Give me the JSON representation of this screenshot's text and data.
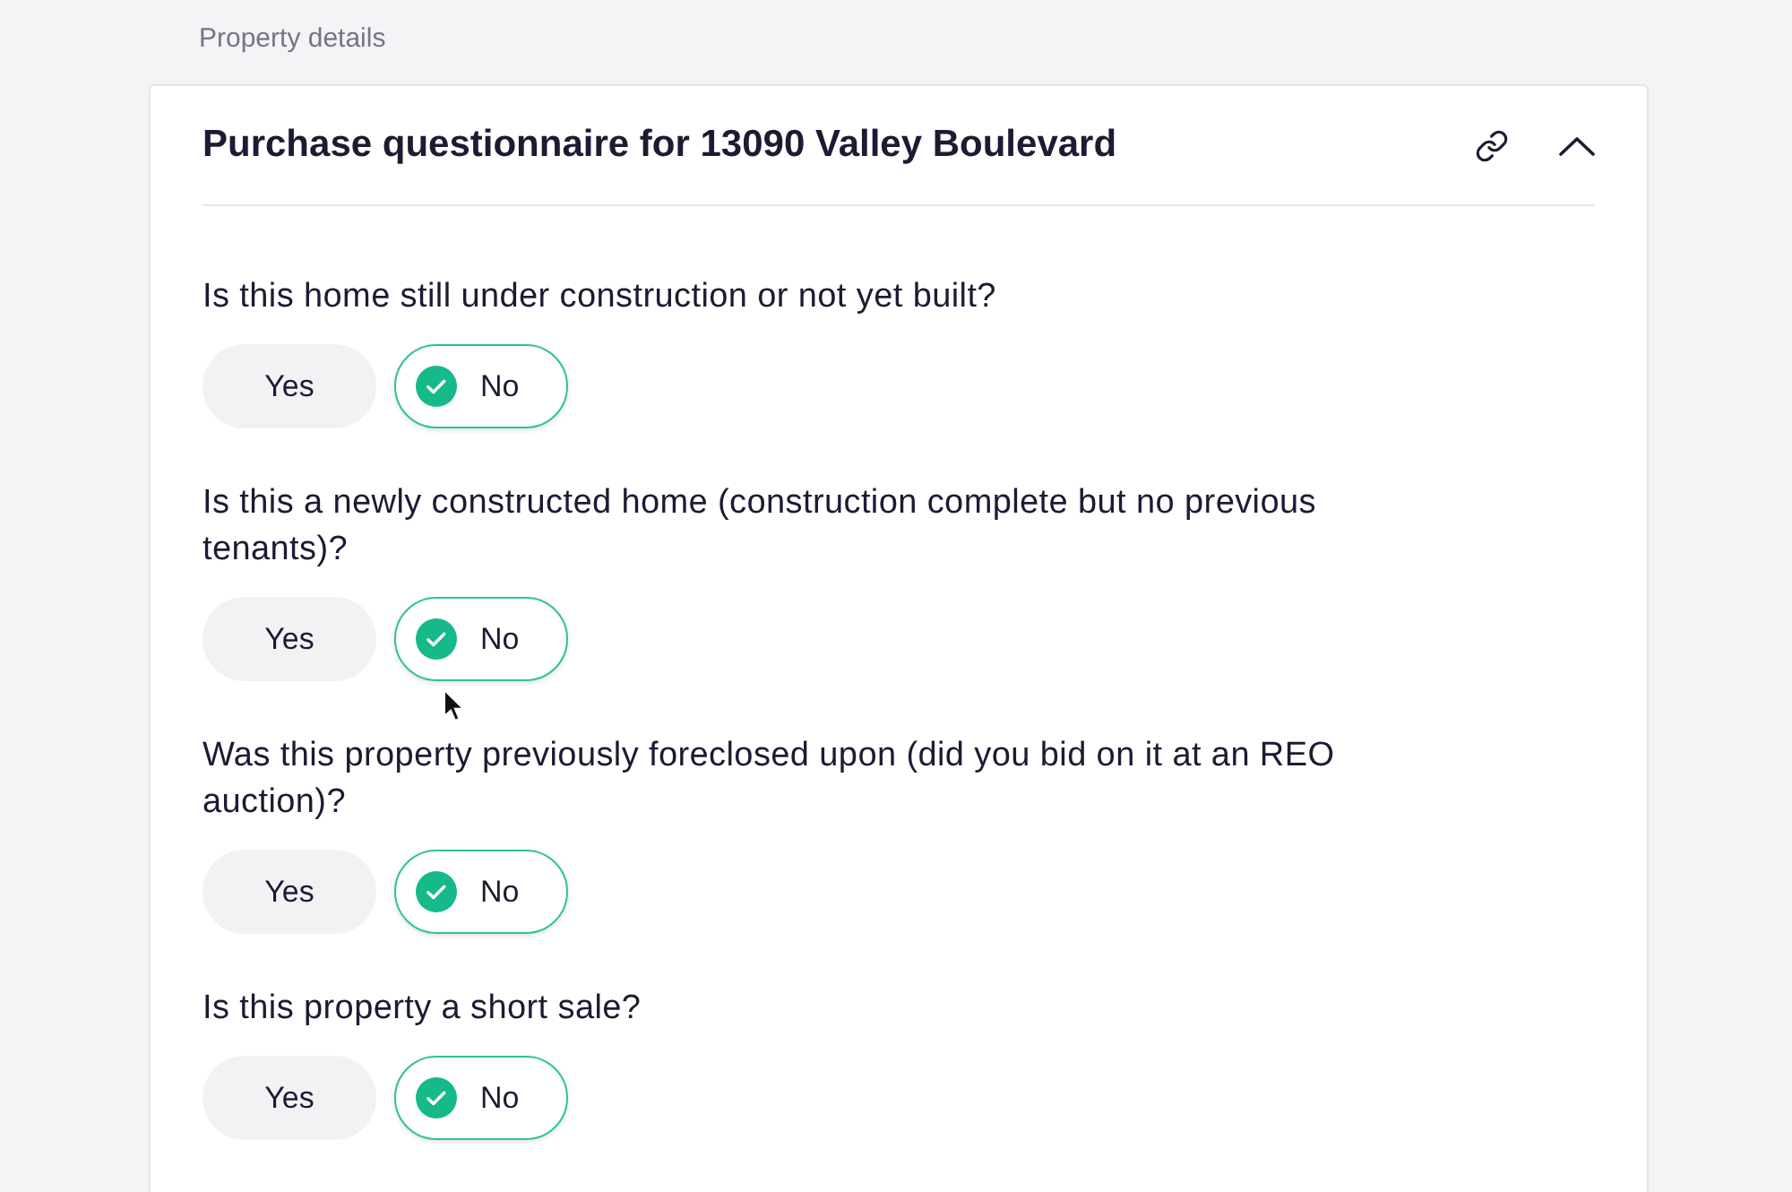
{
  "section_label": "Property details",
  "card": {
    "title": "Purchase questionnaire for 13090 Valley Boulevard",
    "expanded": true
  },
  "questions": [
    {
      "text": "Is this home still under construction or not yet built?",
      "options": [
        {
          "label": "Yes",
          "selected": false
        },
        {
          "label": "No",
          "selected": true
        }
      ]
    },
    {
      "text": "Is this a newly constructed home (construction complete but no previous tenants)?",
      "options": [
        {
          "label": "Yes",
          "selected": false
        },
        {
          "label": "No",
          "selected": true
        }
      ]
    },
    {
      "text": "Was this property previously foreclosed upon (did you bid on it at an REO auction)?",
      "options": [
        {
          "label": "Yes",
          "selected": false
        },
        {
          "label": "No",
          "selected": true
        }
      ]
    },
    {
      "text": "Is this property a short sale?",
      "options": [
        {
          "label": "Yes",
          "selected": false
        },
        {
          "label": "No",
          "selected": true
        }
      ]
    }
  ]
}
